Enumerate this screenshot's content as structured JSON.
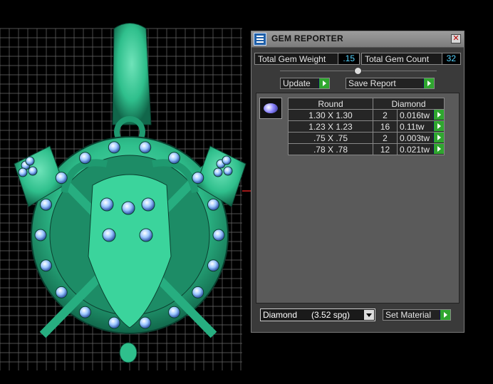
{
  "window": {
    "title": "GEM REPORTER",
    "close_label": "✕",
    "app_icon": "report-grid-icon"
  },
  "summary": {
    "weight_label": "Total Gem Weight",
    "weight_value": ".15",
    "count_label": "Total Gem Count",
    "count_value": "32"
  },
  "buttons": {
    "update_label": "Update",
    "save_report_label": "Save Report",
    "set_material_label": "Set Material"
  },
  "table": {
    "shape_header": "Round",
    "material_header": "Diamond",
    "rows": [
      {
        "size": "1.30 X 1.30",
        "count": "2",
        "weight": "0.016tw"
      },
      {
        "size": "1.23 X 1.23",
        "count": "16",
        "weight": "0.11tw"
      },
      {
        "size": ".75 X .75",
        "count": "2",
        "weight": "0.003tw"
      },
      {
        "size": ".78 X .78",
        "count": "12",
        "weight": "0.021tw"
      }
    ]
  },
  "material_select": {
    "value": "Diamond      (3.52 spg)"
  },
  "colors": {
    "model": "#2fbf8c",
    "gems": "#7fb8ff",
    "grid": "#6a6a6a",
    "play_button": "#2fa62f",
    "value_text": "#55d4ff"
  }
}
